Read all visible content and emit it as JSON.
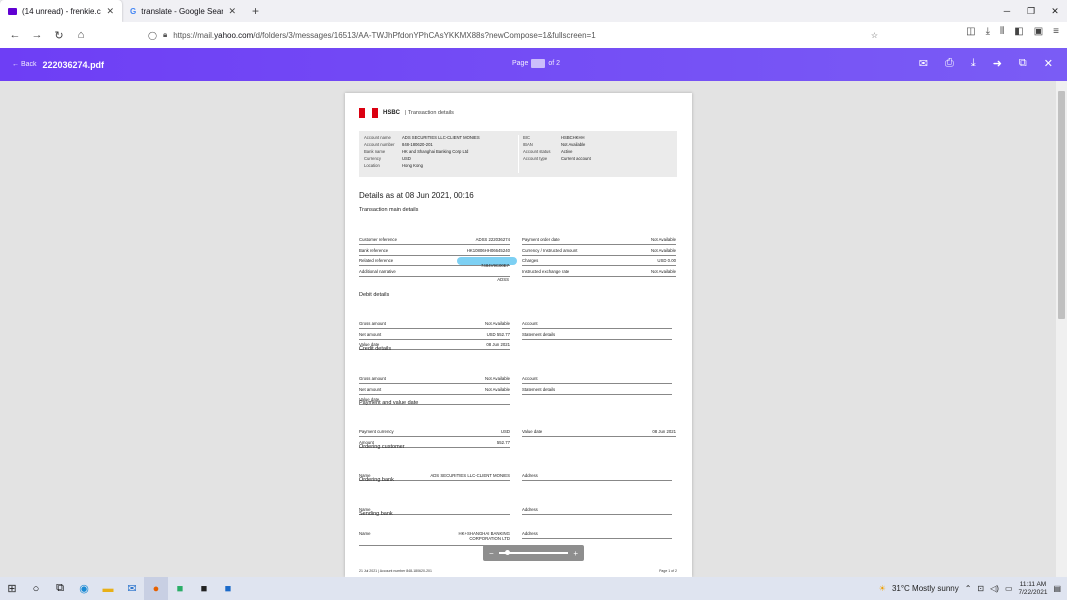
{
  "tabs": [
    {
      "title": "(14 unread) - frenkie.chew@yal",
      "close": "✕"
    },
    {
      "title": "translate - Google Search",
      "close": "✕"
    }
  ],
  "new_tab": "+",
  "window_controls": {
    "min": "─",
    "restore": "❐",
    "close": "✕"
  },
  "nav": {
    "back": "←",
    "forward": "→",
    "reload": "↻",
    "home": "⌂",
    "url_prefix": "https://mail.",
    "url_domain": "yahoo.com",
    "url_rest": "/d/folders/3/messages/16513/AA-TWJhPfdonYPhCAsYKKMX88s?newCompose=1&fullscreen=1"
  },
  "viewer": {
    "back": "← Back",
    "filename": "222036274.pdf",
    "page_label": "Page",
    "page_total": "of 2"
  },
  "doc": {
    "bank": "HSBC",
    "header": "| Transaction details",
    "info_left": [
      [
        "Account name",
        "ADS SECURITIES LLC-CLIENT MONIES"
      ],
      [
        "Account number",
        "848-180620-201"
      ],
      [
        "Bank name",
        "HK and Shanghai Banking Corp Ltd"
      ],
      [
        "Currency",
        "USD"
      ],
      [
        "Location",
        "Hong Kong"
      ]
    ],
    "info_right": [
      [
        "BIC",
        "HSBCHKHH"
      ],
      [
        "IBAN",
        "Not Available"
      ],
      [
        "Account status",
        "Active"
      ],
      [
        "Account type",
        "Current account"
      ]
    ],
    "details_as_at": "Details as at 08 Jun 2021, 00:16",
    "main_title": "Transaction main details",
    "main_left": [
      [
        "Customer reference",
        "ADSS 222036274"
      ],
      [
        "Bank reference",
        "HK10806HH06645240"
      ],
      [
        "Related reference",
        "HK10806HH06645240"
      ],
      [
        "Additional narrative",
        ""
      ]
    ],
    "narr1": "7484V9C00E7",
    "narr2": "ADSS",
    "main_right": [
      [
        "Payment order date",
        "Not Available"
      ],
      [
        "Currency / Instructed amount",
        "Not Available"
      ],
      [
        "Charges",
        "USD 0.00"
      ],
      [
        "Instructed exchange rate",
        "Not Available"
      ]
    ],
    "debit_title": "Debit details",
    "debit_left": [
      [
        "Gross amount",
        "Not Available"
      ],
      [
        "Net amount",
        "USD 552.77"
      ],
      [
        "Value date",
        "08 Jun 2021"
      ]
    ],
    "debit_right": [
      [
        "Account",
        ""
      ],
      [
        "Statement details",
        ""
      ]
    ],
    "credit_title": "Credit details",
    "credit_left": [
      [
        "Gross amount",
        "Not Available"
      ],
      [
        "Net amount",
        "Not Available"
      ],
      [
        "Value date",
        ""
      ]
    ],
    "credit_right": [
      [
        "Account",
        ""
      ],
      [
        "Statement details",
        ""
      ]
    ],
    "pv_title": "Payment and value date",
    "pv_left": [
      [
        "Payment currency",
        "USD"
      ],
      [
        "Amount",
        "552.77"
      ]
    ],
    "pv_right": [
      [
        "Value date",
        "08 Jun 2021"
      ]
    ],
    "oc_title": "Ordering customer",
    "oc_left": [
      [
        "Name",
        "ADS SECURITIES LLC-CLIENT MONIES"
      ]
    ],
    "oc_right": [
      [
        "Address",
        ""
      ]
    ],
    "ob_title": "Ordering bank",
    "ob_left": [
      [
        "Name",
        ""
      ]
    ],
    "ob_right": [
      [
        "Address",
        ""
      ]
    ],
    "sb_title": "Sending bank",
    "sb_name_label": "Name",
    "sb_name_value1": "HK+SHANGHAI BANKING",
    "sb_name_value2": "CORPORATION LTD",
    "sb_address": "Address",
    "footer_left": "21 Jul 2021 | Account number 848-180620-201",
    "footer_right": "Page 1 of 2"
  },
  "zoom": {
    "minus": "−",
    "plus": "+"
  },
  "tray": {
    "weather": "31°C  Mostly sunny",
    "time": "11:11 AM",
    "date": "7/22/2021"
  }
}
